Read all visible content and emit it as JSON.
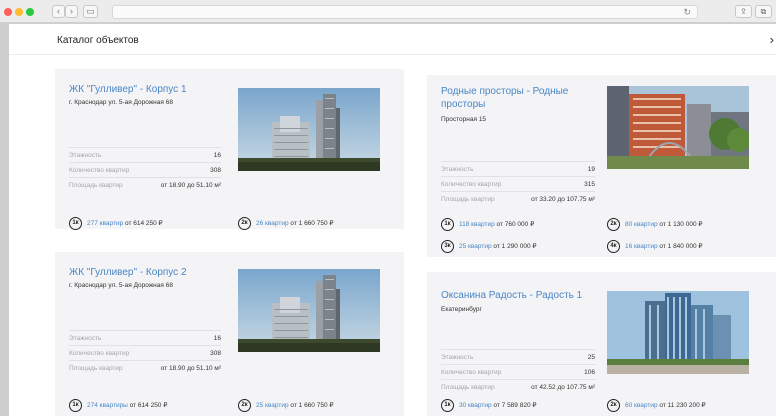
{
  "browser": {
    "back_glyph": "‹",
    "forward_glyph": "›",
    "sidebar_glyph": "▭",
    "reload_glyph": "↻",
    "share_glyph": "⇪",
    "tabs_glyph": "⧉"
  },
  "header": {
    "title": "Каталог объектов",
    "close_glyph": "›"
  },
  "cards": [
    {
      "title": "ЖК \"Гулливер\" - Корпус 1",
      "address": "г. Краснодар ул. 5-ая Дорожная 68",
      "props": [
        {
          "label": "Этажность",
          "value": "16"
        },
        {
          "label": "Количество квартир",
          "value": "308"
        },
        {
          "label": "Площадь квартир",
          "value": "от 18.90 до 51.10 м²"
        }
      ],
      "offers": [
        {
          "badge": "1к",
          "count": "277 квартир",
          "price": "от 614 250 ₽"
        },
        {
          "badge": "2к",
          "count": "26 квартир",
          "price": "от 1 660 750 ₽"
        }
      ]
    },
    {
      "title": "Родные просторы - Родные просторы",
      "address": "Просторная 15",
      "props": [
        {
          "label": "Этажность",
          "value": "19"
        },
        {
          "label": "Количество квартир",
          "value": "315"
        },
        {
          "label": "Площадь квартир",
          "value": "от 33.20 до 107.75 м²"
        }
      ],
      "offers": [
        {
          "badge": "1к",
          "count": "118 квартир",
          "price": "от 760 000 ₽"
        },
        {
          "badge": "2к",
          "count": "80 квартир",
          "price": "от 1 130 000 ₽"
        },
        {
          "badge": "3к",
          "count": "25 квартир",
          "price": "от 1 290 000 ₽"
        },
        {
          "badge": "4к",
          "count": "16 квартир",
          "price": "от 1 840 000 ₽"
        }
      ]
    },
    {
      "title": "ЖК \"Гулливер\" - Корпус 2",
      "address": "г. Краснодар ул. 5-ая Дорожная 68",
      "props": [
        {
          "label": "Этажность",
          "value": "16"
        },
        {
          "label": "Количество квартир",
          "value": "308"
        },
        {
          "label": "Площадь квартир",
          "value": "от 18.90 до 51.10 м²"
        }
      ],
      "offers": [
        {
          "badge": "1к",
          "count": "274 квартиры",
          "price": "от 614 250 ₽"
        },
        {
          "badge": "2к",
          "count": "25 квартир",
          "price": "от 1 660 750 ₽"
        }
      ]
    },
    {
      "title": "Оксанина Радость - Радость 1",
      "address": "Екатеринбург",
      "props": [
        {
          "label": "Этажность",
          "value": "25"
        },
        {
          "label": "Количество квартир",
          "value": "106"
        },
        {
          "label": "Площадь квартир",
          "value": "от 42.52 до 107.75 м²"
        }
      ],
      "offers": [
        {
          "badge": "1к",
          "count": "30 квартир",
          "price": "от 7 589 820 ₽"
        },
        {
          "badge": "2к",
          "count": "60 квартир",
          "price": "от 11 230 200 ₽"
        }
      ]
    }
  ]
}
